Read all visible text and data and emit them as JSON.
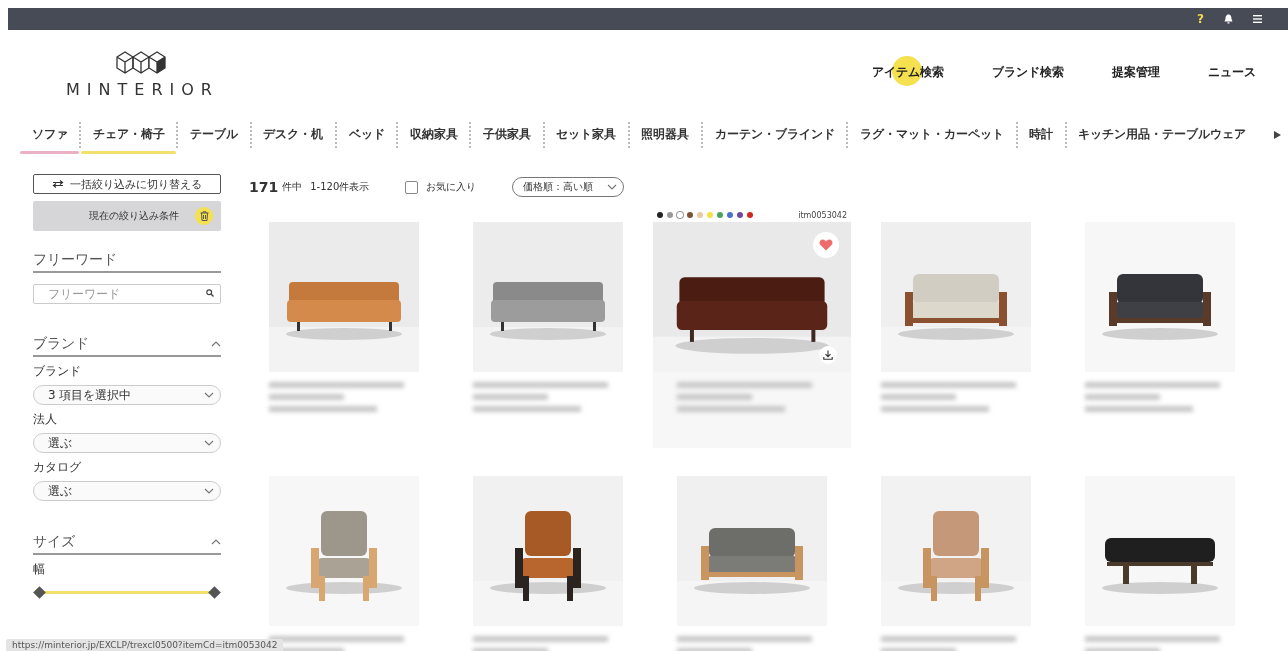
{
  "top_bar": {
    "help": "?"
  },
  "logo": {
    "text": "MINTERIOR"
  },
  "nav": [
    {
      "label": "アイテム検索",
      "selected": true
    },
    {
      "label": "ブランド検索",
      "selected": false
    },
    {
      "label": "提案管理",
      "selected": false
    },
    {
      "label": "ニュース",
      "selected": false
    }
  ],
  "categories": [
    {
      "label": "ソファ",
      "color": "#eab0c4"
    },
    {
      "label": "チェア・椅子",
      "color": "#f2e06a"
    },
    {
      "label": "テーブル"
    },
    {
      "label": "デスク・机"
    },
    {
      "label": "ベッド"
    },
    {
      "label": "収納家具"
    },
    {
      "label": "子供家具"
    },
    {
      "label": "セット家具"
    },
    {
      "label": "照明器具"
    },
    {
      "label": "カーテン・ブラインド"
    },
    {
      "label": "ラグ・マット・カーペット"
    },
    {
      "label": "時計"
    },
    {
      "label": "キッチン用品・テーブルウェア"
    }
  ],
  "sidebar": {
    "switch_button": "一括絞り込みに切り替える",
    "conditions": "現在の絞り込み条件",
    "sections": [
      {
        "kind": "search",
        "title": "フリーワード",
        "placeholder": "フリーワード"
      },
      {
        "kind": "selects",
        "title": "ブランド",
        "expanded": true,
        "fields": [
          {
            "label": "ブランド",
            "value": "3 項目を選択中"
          },
          {
            "label": "法人",
            "value": "選ぶ"
          },
          {
            "label": "カタログ",
            "value": "選ぶ"
          }
        ]
      },
      {
        "kind": "range",
        "title": "サイズ",
        "expanded": true,
        "label": "幅",
        "level": 1
      }
    ]
  },
  "results": {
    "count": "171",
    "count_unit": "件中",
    "range": "1-120件表示",
    "favorite_filter": {
      "label": "お気に入り",
      "checked": false
    },
    "sort": "価格順：高い順"
  },
  "products": [
    {
      "kind": "picture"
    },
    {
      "kind": "picture"
    },
    {
      "kind": "picture",
      "favorite": true,
      "highlighted": true,
      "code": "itm0053042",
      "swatches": [
        {
          "color": "#222222"
        },
        {
          "color": "#999999"
        },
        {
          "color": "#ffffff"
        },
        {
          "color": "#7a5236"
        },
        {
          "color": "#e9c9a3"
        },
        {
          "color": "#f3e04a"
        },
        {
          "color": "#4aa35a"
        },
        {
          "color": "#4a74c9"
        },
        {
          "color": "#6b4aa3"
        },
        {
          "color": "#d02a1e"
        }
      ]
    },
    {
      "kind": "picture"
    },
    {
      "kind": "picture"
    },
    {
      "kind": "picture"
    },
    {
      "kind": "picture"
    },
    {
      "kind": "picture"
    },
    {
      "kind": "picture"
    },
    {
      "kind": "picture"
    }
  ],
  "status_url": "https://minterior.jp/EXCLP/trexcl0500?itemCd=itm0053042"
}
